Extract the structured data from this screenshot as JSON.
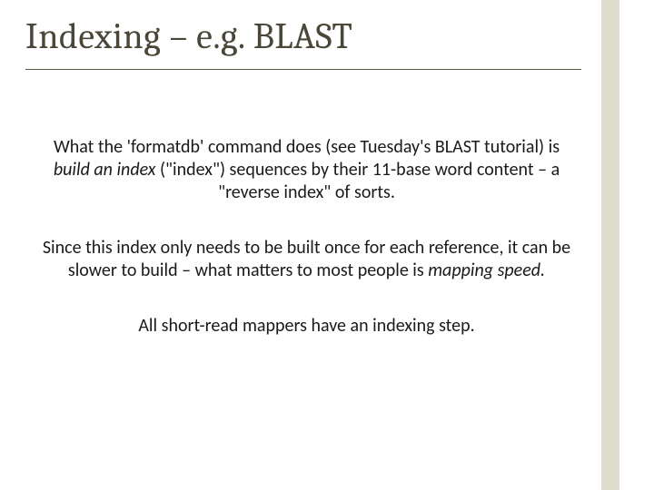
{
  "title": "Indexing – e.g. BLAST",
  "p1_a": "What the 'formatdb' command does (see Tuesday's BLAST tutorial) is ",
  "p1_b": "build an index",
  "p1_c": " (\"index\") sequences by their 11-base word content – a \"reverse index\" of sorts.",
  "p2_a": "Since this index only needs to be built once for each reference, it can be slower to build – what matters to most people is ",
  "p2_b": "mapping speed.",
  "p3": "All short-read mappers have an indexing step."
}
